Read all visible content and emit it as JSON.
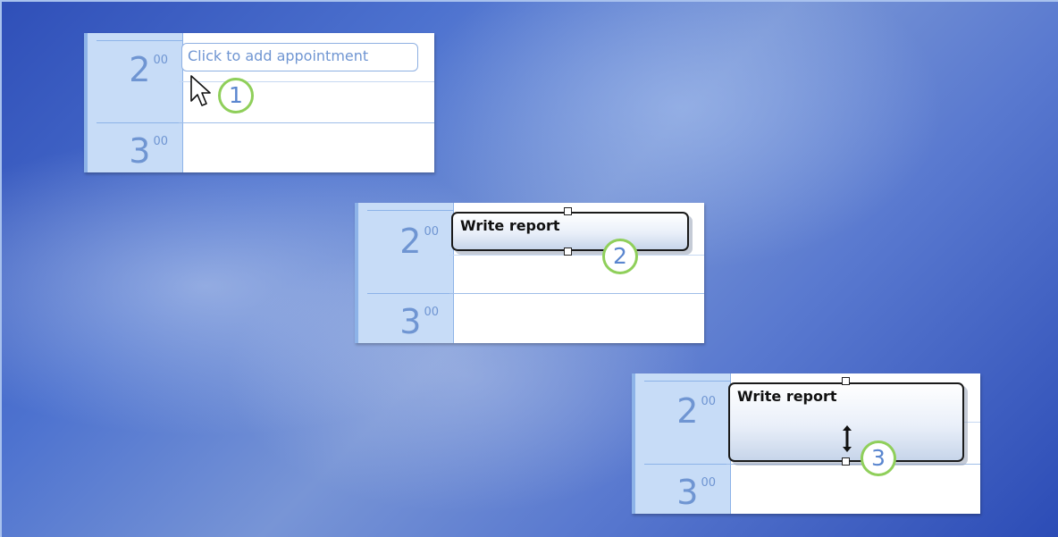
{
  "time_labels": {
    "two": {
      "hour": "2",
      "min": "00"
    },
    "three": {
      "hour": "3",
      "min": "00"
    }
  },
  "step1": {
    "placeholder": "Click to add appointment",
    "callout": "1"
  },
  "step2": {
    "title": "Write report",
    "callout": "2"
  },
  "step3": {
    "title": "Write report",
    "callout": "3"
  },
  "icons": {
    "cursor": "mouse-pointer-icon",
    "resize": "vertical-resize-icon"
  },
  "colors": {
    "hour_text": "#6f95d2",
    "time_column": "#c7dcf7",
    "callout_ring": "#8fcf5a",
    "appointment_border": "#1a1a1a"
  }
}
